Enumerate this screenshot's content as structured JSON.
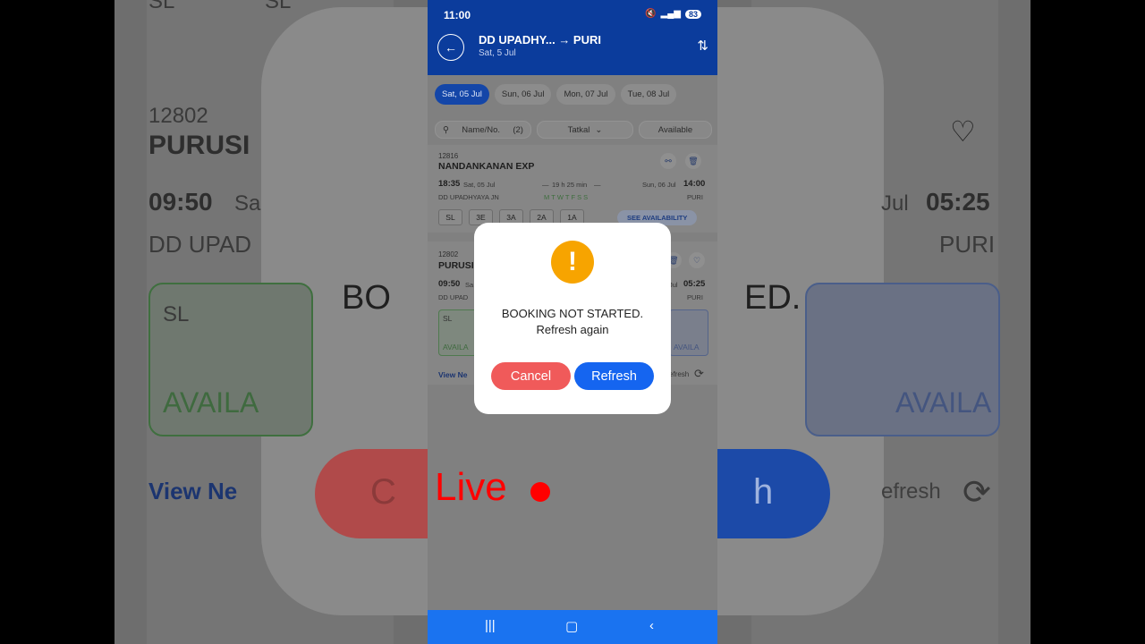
{
  "background": {
    "train_number": "12802",
    "train_name_partial": "PURUSI",
    "dep_time": "09:50",
    "dep_date_partial": "Sa",
    "station_left_partial": "DD UPAD",
    "arr_date_partial": "Jul",
    "arr_time": "05:25",
    "station_right": "PURI",
    "msg_left_partial": "BO",
    "msg_right_partial": "ED.",
    "class_left": "SL",
    "avail_left_partial": "AVAILA",
    "avail_right_partial": "AVAILA",
    "view_partial": "View Ne",
    "refresh_partial": "efresh",
    "btn_left_partial": "C",
    "btn_right_partial": "h",
    "top_partial_1": "SL",
    "top_partial_2": "SL"
  },
  "status_bar": {
    "time": "11:00",
    "battery": "83"
  },
  "header": {
    "route": "DD UPADHY... → PURI",
    "date": "Sat, 5 Jul"
  },
  "date_tabs": [
    {
      "label": "Sat, 05 Jul",
      "active": true
    },
    {
      "label": "Sun, 06 Jul",
      "active": false
    },
    {
      "label": "Mon, 07 Jul",
      "active": false
    },
    {
      "label": "Tue, 08 Jul",
      "active": false
    }
  ],
  "filters": {
    "search_placeholder": "Name/No.",
    "search_count": "(2)",
    "quota": "Tatkal",
    "availability": "Available"
  },
  "trains": [
    {
      "number": "12816",
      "name": "NANDANKANAN EXP",
      "dep_time": "18:35",
      "dep_date": "Sat, 05 Jul",
      "duration": "19 h 25 min",
      "arr_date": "Sun, 06 Jul",
      "arr_time": "14:00",
      "from": "DD UPADHYAYA JN",
      "to": "PURI",
      "days": "MTWTFSS",
      "classes": [
        "SL",
        "3E",
        "3A",
        "2A",
        "1A"
      ],
      "see_availability": "SEE AVAILABILITY"
    },
    {
      "number": "12802",
      "name_partial": "PURUSI",
      "dep_time": "09:50",
      "dep_date_partial": "Sa",
      "arr_date_partial": "Jul",
      "arr_time": "05:25",
      "from_partial": "DD UPAD",
      "to": "PURI",
      "class_partial": "SL",
      "avail_left_partial": "AVAILA",
      "avail_right_partial": "AVAILA",
      "view_partial": "View Ne",
      "refresh_partial": "efresh"
    }
  ],
  "dialog": {
    "title": "BOOKING NOT STARTED.",
    "subtitle": "Refresh again",
    "cancel_label": "Cancel",
    "refresh_label": "Refresh",
    "icon_color": "#f7a400"
  },
  "overlay": {
    "live_label": "Live"
  },
  "colors": {
    "brand": "#0b3c9c",
    "cancel": "#f05a5a",
    "refresh": "#1565f0",
    "live": "#ff0000",
    "nav": "#1a73f0"
  }
}
